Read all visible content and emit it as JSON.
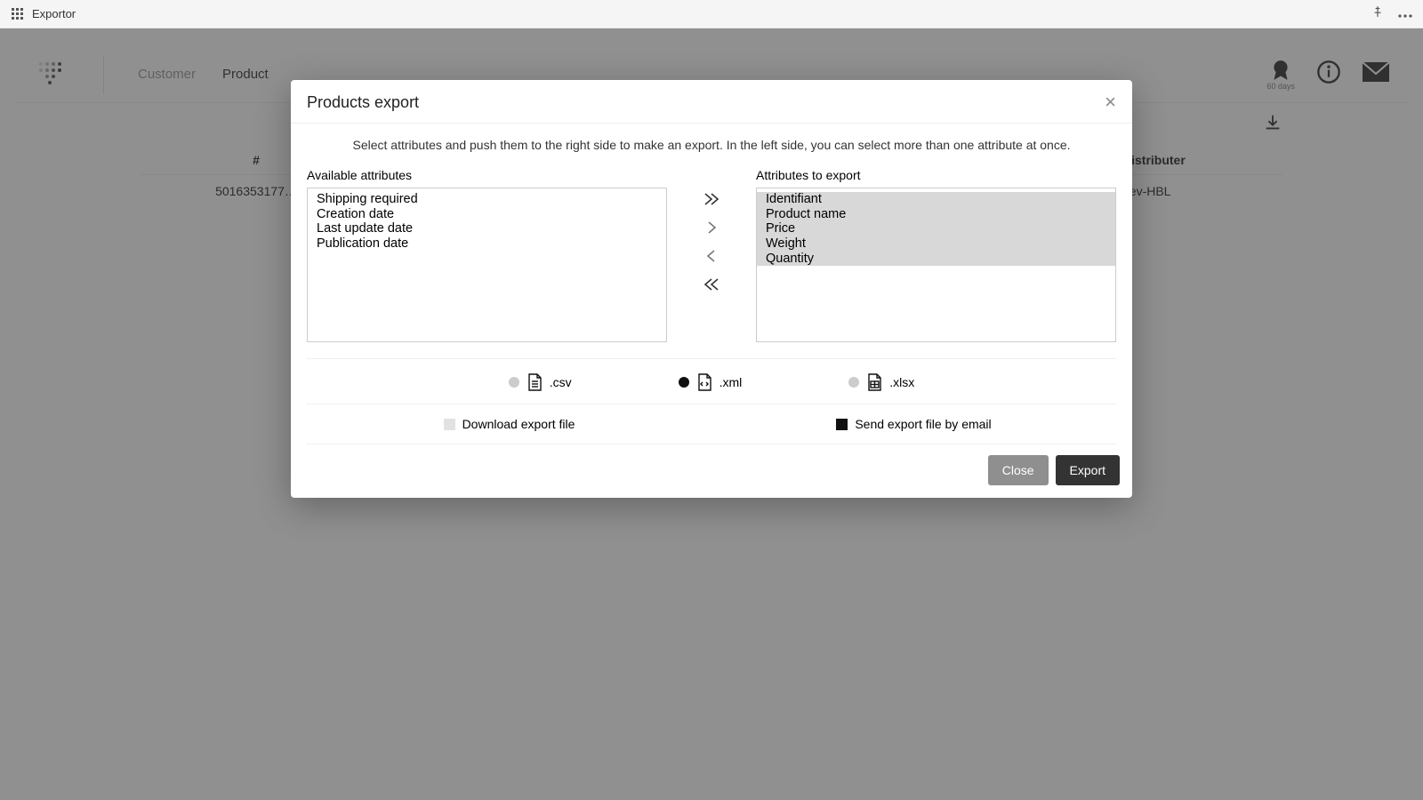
{
  "titlebar": {
    "app_name": "Exportor"
  },
  "nav": {
    "items": [
      {
        "label": "Customer",
        "active": false
      },
      {
        "label": "Product",
        "active": true
      }
    ]
  },
  "header": {
    "badge_text": "60 days"
  },
  "table": {
    "headers": {
      "id": "#",
      "name": "",
      "dist": "Distributer"
    },
    "rows": [
      {
        "id": "5016353177…",
        "name": "",
        "dist": "dev-HBL"
      }
    ]
  },
  "modal": {
    "title": "Products export",
    "instruction": "Select attributes and push them to the right side to make an export. In the left side, you can select more than one attribute at once.",
    "available_label": "Available attributes",
    "export_label": "Attributes to export",
    "available": [
      "Shipping required",
      "Creation date",
      "Last update date",
      "Publication date"
    ],
    "selected": [
      "Identifiant",
      "Product name",
      "Price",
      "Weight",
      "Quantity"
    ],
    "formats": {
      "csv": ".csv",
      "xml": ".xml",
      "xlsx": ".xlsx",
      "selected": "xml"
    },
    "delivery": {
      "download": "Download export file",
      "email": "Send export file by email",
      "download_checked": false,
      "email_checked": true
    },
    "buttons": {
      "close": "Close",
      "export": "Export"
    }
  }
}
